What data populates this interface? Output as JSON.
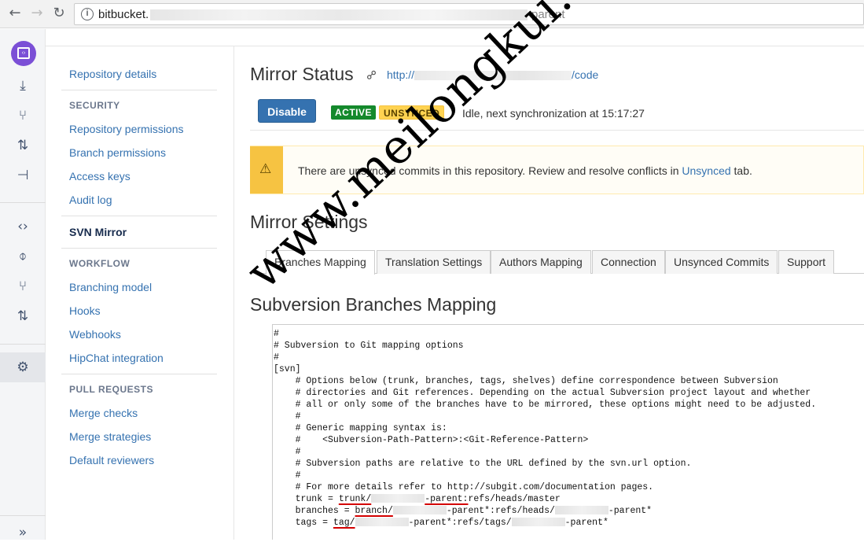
{
  "browser": {
    "url_prefix": "bitbucket.",
    "url_suffix": "-parent"
  },
  "sidebar": {
    "repository_details": "Repository details",
    "security_header": "SECURITY",
    "security_items": [
      "Repository permissions",
      "Branch permissions",
      "Access keys",
      "Audit log"
    ],
    "current": "SVN Mirror",
    "workflow_header": "WORKFLOW",
    "workflow_items": [
      "Branching model",
      "Hooks",
      "Webhooks",
      "HipChat integration"
    ],
    "pull_requests_header": "PULL REQUESTS",
    "pull_requests_items": [
      "Merge checks",
      "Merge strategies",
      "Default reviewers"
    ]
  },
  "mirror_status": {
    "title": "Mirror Status",
    "url_start": "http://",
    "url_end": "/code",
    "disable_label": "Disable",
    "active_badge": "ACTIVE",
    "unsynced_badge": "UNSYNCED",
    "status_text": "Idle, next synchronization at 15:17:27"
  },
  "warning": {
    "text_before": "There are unsynced commits in this repository. Review and resolve conflicts in ",
    "link": "Unsynced",
    "text_after": " tab."
  },
  "settings": {
    "title": "Mirror Settings",
    "tabs": [
      "Branches Mapping",
      "Translation Settings",
      "Authors Mapping",
      "Connection",
      "Unsynced Commits",
      "Support"
    ],
    "active_tab": "Branches Mapping",
    "section_title": "Subversion Branches Mapping"
  },
  "config": {
    "lines": [
      "#",
      "# Subversion to Git mapping options",
      "#",
      "[svn]",
      "    # Options below (trunk, branches, tags, shelves) define correspondence between Subversion",
      "    # directories and Git references. Depending on the actual Subversion project layout and whether",
      "    # all or only some of the branches have to be mirrored, these options might need to be adjusted.",
      "    #",
      "    # Generic mapping syntax is:",
      "    #    <Subversion-Path-Pattern>:<Git-Reference-Pattern>",
      "    #",
      "    # Subversion paths are relative to the URL defined by the svn.url option.",
      "    #",
      "    # For more details refer to http://subgit.com/documentation pages."
    ],
    "trunk_a": "    trunk = ",
    "trunk_b": "trunk/",
    "trunk_c": "-parent:",
    "trunk_d": "refs/heads/master",
    "branches_a": "    branches = ",
    "branches_b": "branch/",
    "branches_c": "-parent*:refs/heads/",
    "branches_d": "-parent*",
    "tags_a": "    tags = ",
    "tags_b": "tag/",
    "tags_c": "-parent*:refs/tags/",
    "tags_d": "-parent*"
  },
  "watermark": "www.meilongkui.com"
}
